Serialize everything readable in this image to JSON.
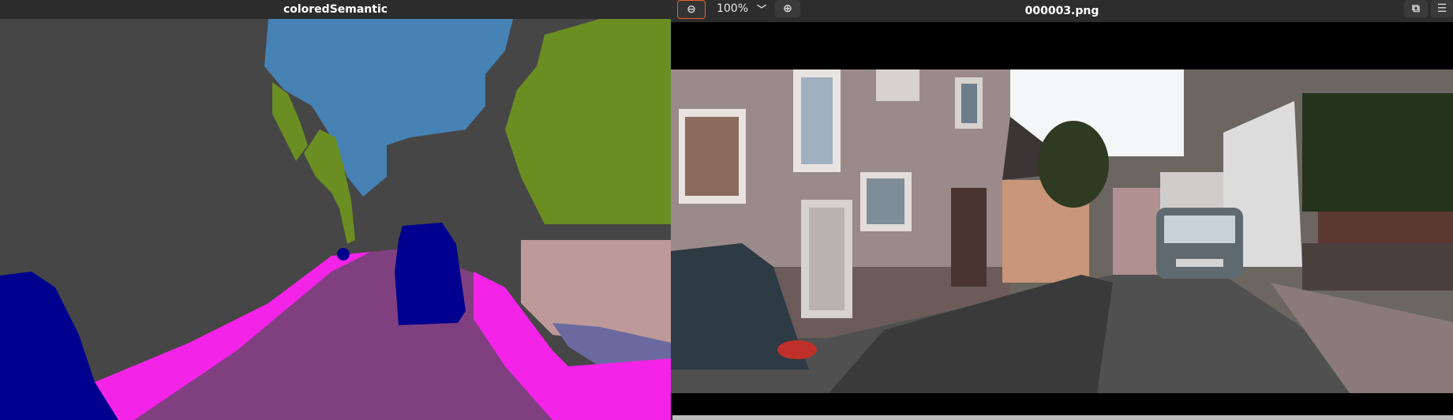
{
  "left_window": {
    "title": "coloredSemantic"
  },
  "right_window": {
    "title": "000003.png",
    "toolbar": {
      "zoom_value": "100%",
      "zoom_out_icon": "zoom-out-icon",
      "zoom_in_icon": "zoom-in-icon",
      "dropdown_icon": "chevron-down-icon",
      "restore_icon": "window-restore-icon",
      "menu_icon": "hamburger-menu-icon"
    }
  },
  "colors": {
    "building": "#464646",
    "sky": "#4682b4",
    "vegetation": "#6b8e23",
    "road": "#804080",
    "sidewalk": "#f423e8",
    "car": "#00008e",
    "wall": "#be9999",
    "terrain": "#6a6aa0"
  }
}
